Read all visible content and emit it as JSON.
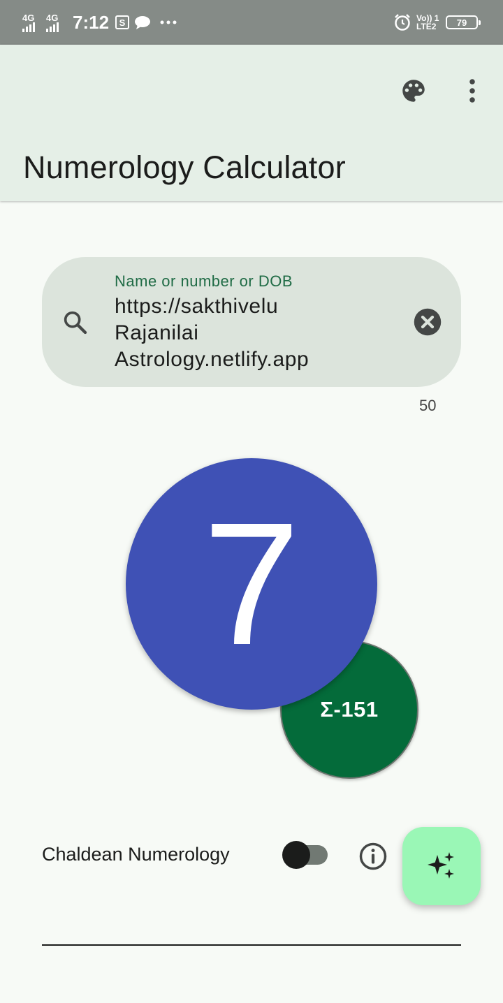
{
  "status_bar": {
    "signal_1": "4G",
    "signal_2": "4G",
    "time": "7:12",
    "notification_icons": [
      "screenshot-icon",
      "message-bubble-icon",
      "more-dots-icon"
    ],
    "alarm_icon": "alarm-clock-icon",
    "network_top": "Vo)) 1",
    "network_bottom": "LTE2",
    "battery": "79"
  },
  "app_bar": {
    "title": "Numerology Calculator",
    "actions": [
      "palette-icon",
      "more-vert-icon"
    ]
  },
  "search": {
    "label": "Name or number or DOB",
    "value": "https://sakthivelu\nRajanilai\nAstrology.netlify.app",
    "char_count": "50",
    "leading_icon": "search-icon",
    "trailing_icon": "clear-icon"
  },
  "result": {
    "number": "7",
    "sum": "Σ-151",
    "primary_color": "#3f51b5",
    "secondary_color": "#046b3a"
  },
  "options": {
    "chaldean_label": "Chaldean Numerology",
    "chaldean_enabled": false,
    "info_icon": "info-icon"
  },
  "fab": {
    "icon": "sparkles-icon",
    "color": "#9af7b6"
  }
}
